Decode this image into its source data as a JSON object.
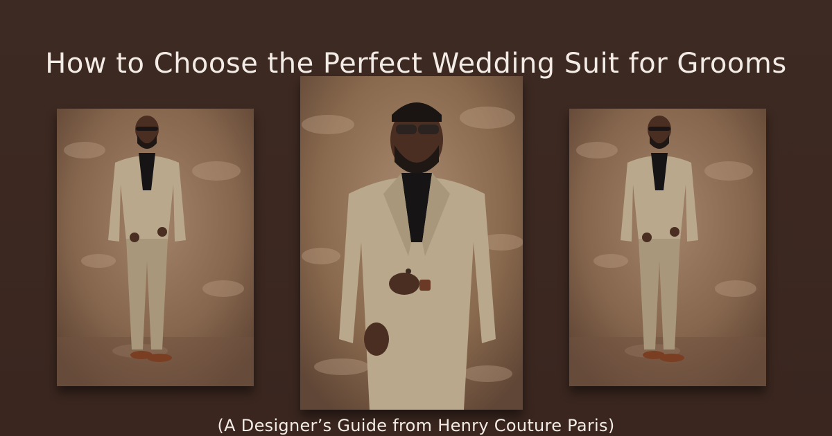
{
  "banner": {
    "title": "How to Choose the Perfect Wedding Suit for Grooms",
    "subtitle": "(A Designer’s Guide from Henry Couture Paris)"
  },
  "photos": [
    {
      "id": "left",
      "framing": "full-body"
    },
    {
      "id": "center",
      "framing": "half-body"
    },
    {
      "id": "right",
      "framing": "full-body"
    }
  ],
  "colors": {
    "background": "#3b2720",
    "text": "#f3ece6",
    "backdrop": "#8a6a4e",
    "suit": "#b9a88c",
    "shirt": "#161414",
    "skin": "#4a2e22",
    "shoes": "#7a3e22"
  }
}
